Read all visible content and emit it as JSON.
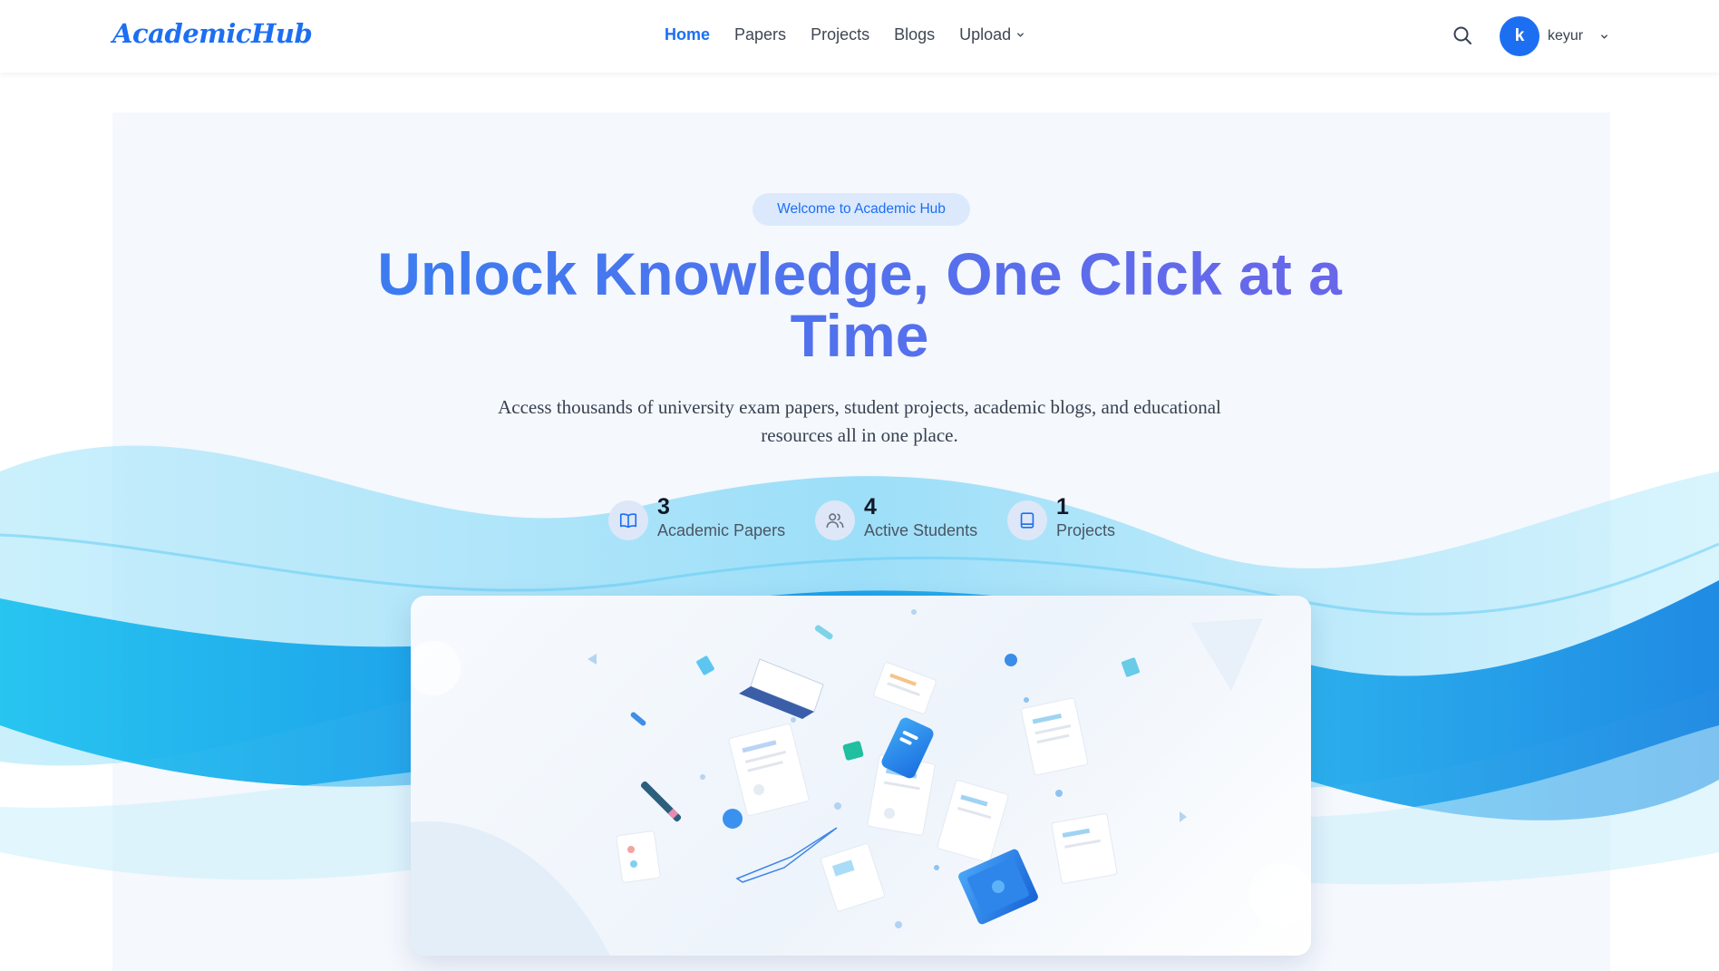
{
  "brand": {
    "name": "AcademicHub"
  },
  "nav": {
    "items": [
      {
        "label": "Home",
        "active": true
      },
      {
        "label": "Papers"
      },
      {
        "label": "Projects"
      },
      {
        "label": "Blogs"
      },
      {
        "label": "Upload",
        "has_dropdown": true
      }
    ]
  },
  "user": {
    "initial": "k",
    "name": "keyur"
  },
  "hero": {
    "badge": "Welcome to Academic Hub",
    "headline": "Unlock Knowledge, One Click at a Time",
    "subtext": "Access thousands of university exam papers, student projects, academic blogs, and educational resources all in one place."
  },
  "stats": [
    {
      "value": "3",
      "label": "Academic Papers",
      "icon": "book-open-icon"
    },
    {
      "value": "4",
      "label": "Active Students",
      "icon": "users-icon"
    },
    {
      "value": "1",
      "label": "Projects",
      "icon": "book-icon"
    }
  ],
  "colors": {
    "accent": "#1d6ff2",
    "headline_start": "#3b7df0",
    "headline_end": "#6a66ea"
  }
}
